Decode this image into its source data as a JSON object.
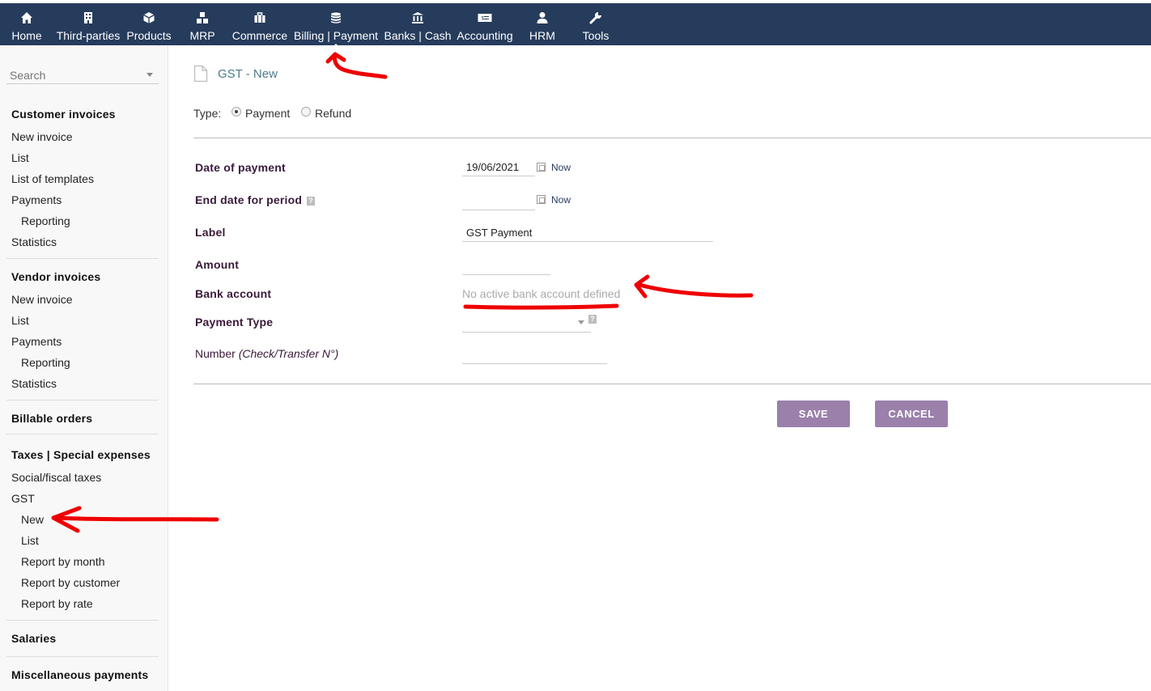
{
  "colors": {
    "topbar": "#263c5c",
    "button": "#9a80ab",
    "title": "#4a7d8c",
    "annotation": "#ee0000"
  },
  "nav": {
    "items": [
      {
        "label": "Home",
        "icon": "home-icon"
      },
      {
        "label": "Third-parties",
        "icon": "building-icon"
      },
      {
        "label": "Products",
        "icon": "cube-icon"
      },
      {
        "label": "MRP",
        "icon": "cubes-icon"
      },
      {
        "label": "Commerce",
        "icon": "briefcase-icon"
      },
      {
        "label": "Billing | Payment",
        "icon": "coins-icon"
      },
      {
        "label": "Banks | Cash",
        "icon": "bank-icon"
      },
      {
        "label": "Accounting",
        "icon": "money-bill-icon"
      },
      {
        "label": "HRM",
        "icon": "user-icon"
      },
      {
        "label": "Tools",
        "icon": "wrench-icon"
      }
    ],
    "active": "Billing | Payment"
  },
  "sidebar": {
    "search_placeholder": "Search",
    "customer": {
      "title": "Customer invoices",
      "new_invoice": "New invoice",
      "list": "List",
      "templates": "List of templates",
      "payments": "Payments",
      "reporting": "Reporting",
      "statistics": "Statistics"
    },
    "vendor": {
      "title": "Vendor invoices",
      "new_invoice": "New invoice",
      "list": "List",
      "payments": "Payments",
      "reporting": "Reporting",
      "statistics": "Statistics"
    },
    "billable_orders": "Billable orders",
    "taxes": {
      "title": "Taxes | Special expenses",
      "social": "Social/fiscal taxes",
      "gst": "GST",
      "new": "New",
      "list": "List",
      "by_month": "Report by month",
      "by_customer": "Report by customer",
      "by_rate": "Report by rate"
    },
    "salaries": "Salaries",
    "misc": "Miscellaneous payments"
  },
  "page": {
    "title": "GST - New",
    "type_label": "Type:",
    "type_payment": "Payment",
    "type_refund": "Refund",
    "type_selected": "Payment"
  },
  "form": {
    "date_of_payment": {
      "label": "Date of payment",
      "value": "19/06/2021",
      "now": "Now"
    },
    "end_date": {
      "label": "End date for period",
      "value": "",
      "now": "Now"
    },
    "label": {
      "label": "Label",
      "value": "GST Payment"
    },
    "amount": {
      "label": "Amount",
      "value": ""
    },
    "bank_account": {
      "label": "Bank account",
      "value": "No active bank account defined"
    },
    "payment_type": {
      "label": "Payment Type",
      "value": ""
    },
    "number": {
      "label": "Number",
      "hint": "(Check/Transfer N°)",
      "value": ""
    }
  },
  "buttons": {
    "save": "SAVE",
    "cancel": "CANCEL"
  }
}
